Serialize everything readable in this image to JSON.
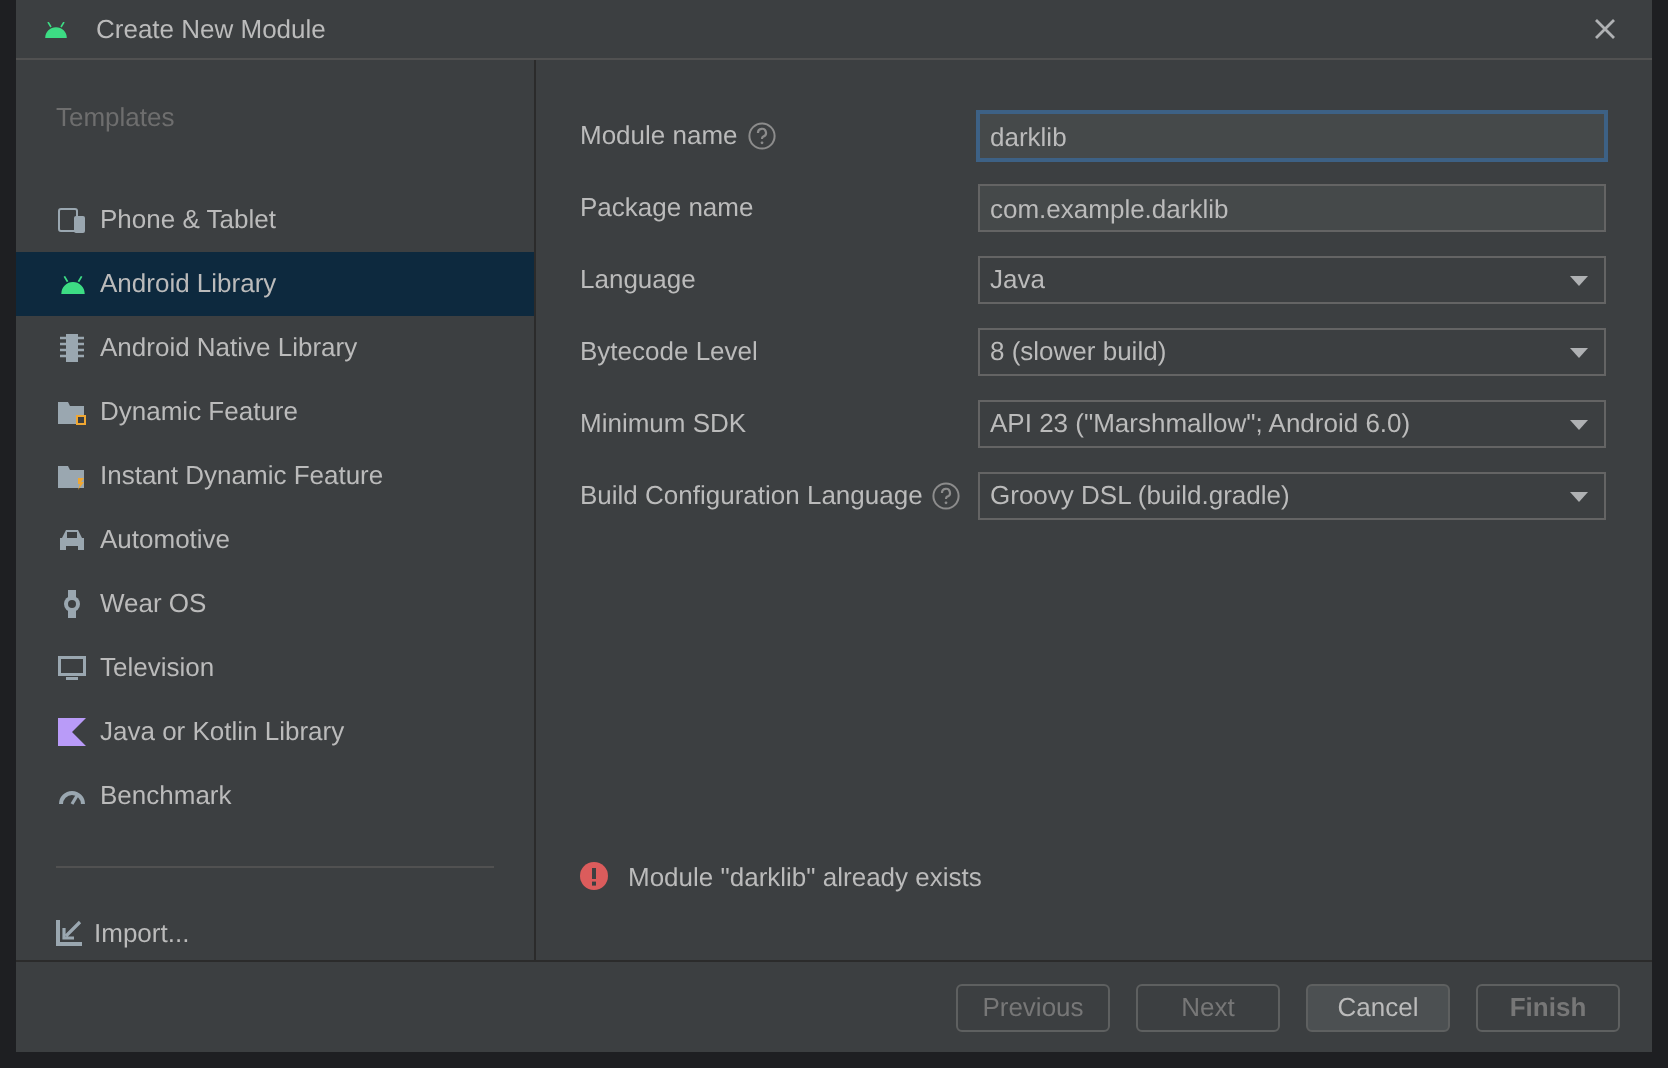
{
  "window": {
    "title": "Create New Module"
  },
  "sidebar": {
    "heading": "Templates",
    "items": [
      {
        "label": "Phone & Tablet",
        "kind": "phone",
        "selected": false
      },
      {
        "label": "Android Library",
        "kind": "android",
        "selected": true
      },
      {
        "label": "Android Native Library",
        "kind": "chip",
        "selected": false
      },
      {
        "label": "Dynamic Feature",
        "kind": "folder",
        "selected": false
      },
      {
        "label": "Instant Dynamic Feature",
        "kind": "folder-bolt",
        "selected": false
      },
      {
        "label": "Automotive",
        "kind": "car",
        "selected": false
      },
      {
        "label": "Wear OS",
        "kind": "watch",
        "selected": false
      },
      {
        "label": "Television",
        "kind": "tv",
        "selected": false
      },
      {
        "label": "Java or Kotlin Library",
        "kind": "kotlin",
        "selected": false
      },
      {
        "label": "Benchmark",
        "kind": "gauge",
        "selected": false
      }
    ],
    "import": {
      "label": "Import..."
    }
  },
  "form": [
    {
      "label": "Module name",
      "help": true,
      "kind": "text",
      "value": "darklib",
      "focused": true
    },
    {
      "label": "Package name",
      "help": false,
      "kind": "text",
      "value": "com.example.darklib",
      "focused": false
    },
    {
      "label": "Language",
      "help": false,
      "kind": "dropdown",
      "value": "Java",
      "focused": false
    },
    {
      "label": "Bytecode Level",
      "help": false,
      "kind": "dropdown",
      "value": "8 (slower build)",
      "focused": false
    },
    {
      "label": "Minimum SDK",
      "help": false,
      "kind": "dropdown",
      "value": "API 23 (\"Marshmallow\"; Android 6.0)",
      "focused": false
    },
    {
      "label": "Build Configuration Language",
      "help": true,
      "kind": "dropdown",
      "value": "Groovy DSL (build.gradle)",
      "focused": false
    }
  ],
  "error": "Module \"darklib\" already exists",
  "buttons": [
    {
      "label": "Previous",
      "disabled": true
    },
    {
      "label": "Next",
      "disabled": true
    },
    {
      "label": "Cancel",
      "disabled": false
    },
    {
      "label": "Finish",
      "disabled": true
    }
  ]
}
